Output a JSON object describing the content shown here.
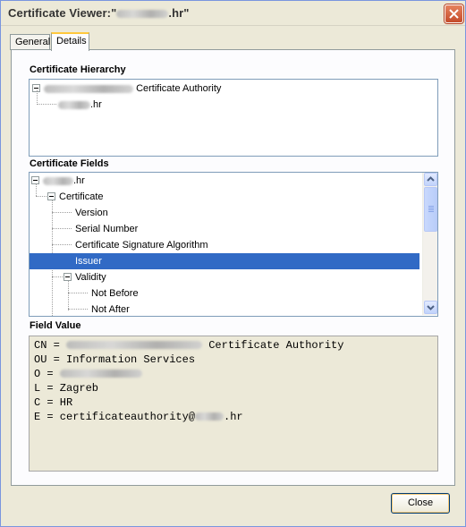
{
  "window": {
    "title_prefix": "Certificate Viewer:\"",
    "title_suffix": ".hr\""
  },
  "tabs": [
    {
      "label": "General"
    },
    {
      "label": "Details"
    }
  ],
  "hierarchy": {
    "label": "Certificate Hierarchy",
    "items": [
      {
        "text": "Certificate Authority"
      },
      {
        "text": ".hr"
      }
    ]
  },
  "fields": {
    "label": "Certificate Fields",
    "items": [
      {
        "text": ".hr"
      },
      {
        "text": "Certificate"
      },
      {
        "text": "Version"
      },
      {
        "text": "Serial Number"
      },
      {
        "text": "Certificate Signature Algorithm"
      },
      {
        "text": "Issuer"
      },
      {
        "text": "Validity"
      },
      {
        "text": "Not Before"
      },
      {
        "text": "Not After"
      }
    ],
    "selected": "Issuer"
  },
  "field_value": {
    "label": "Field Value",
    "lines": [
      {
        "prefix": "CN = ",
        "suffix": " Certificate Authority"
      },
      {
        "prefix": "OU = Information Services",
        "suffix": ""
      },
      {
        "prefix": "O = ",
        "suffix": ""
      },
      {
        "prefix": "L = Zagreb",
        "suffix": ""
      },
      {
        "prefix": "C = HR",
        "suffix": ""
      },
      {
        "prefix": "E = certificateauthority@",
        "suffix": ".hr"
      }
    ]
  },
  "buttons": {
    "close_label": "Close"
  },
  "colors": {
    "selection": "#316ac5",
    "tab_highlight": "#ffc83c",
    "dialog_bg": "#ece9d8"
  }
}
